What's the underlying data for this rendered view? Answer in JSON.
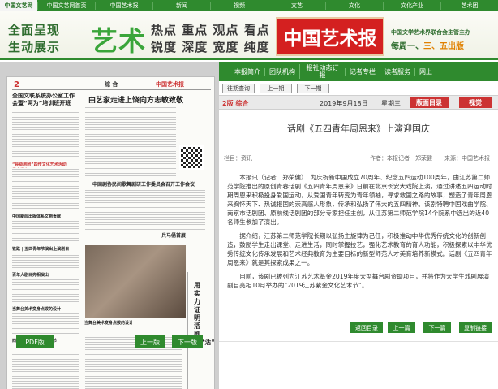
{
  "top_nav": {
    "logo": "中国文艺网",
    "items": [
      "中国文艺网首页",
      "中国艺术报",
      "新闻",
      "视频",
      "文艺",
      "文化",
      "文化产业",
      "艺术团"
    ]
  },
  "banner": {
    "line1": "全面呈现",
    "line2": "生动展示",
    "art": "艺术",
    "keywords1": "热点 重点 观点 看点",
    "keywords2": "锐度 深度 宽度 纯度",
    "masthead": "中国艺术报",
    "publisher": "中国文学艺术界联合会主管主办",
    "issue_prefix": "每周一、",
    "issue_days": "三、五出版"
  },
  "paper": {
    "page_num": "2",
    "section": "综 合",
    "masthead": "中国艺术报",
    "headline_left": "全国文联系统办公室工作会暨“两为”培训班开班",
    "headline_main": "由艺家走进上饶向方志敏致敬",
    "headline_red": "“县级剧团”四传文化艺术活动常态举办",
    "headline_mid": "中国剧协民间歌舞剧研工作委员会召开工作会议",
    "headline_b1": "中国新闻出版体系文物贡献",
    "headline_b2": "铁路 | 五四青年节演出上演剧目",
    "headline_b3": "百年大剧目亮相演出",
    "headline_b4": "当舞台美术变身点拨的设计",
    "headline_b5": "西藏山南文化表演艺术节",
    "headline_b6": "兵马俑首展",
    "headline_vert": "用实力证明活剧性“活”"
  },
  "left_buttons": {
    "pdf": "PDF版",
    "prev": "上一版",
    "next": "下一版"
  },
  "right_nav": {
    "items": [
      "本报简介",
      "团队机构",
      "报社动态订报",
      "记者专栏",
      "读者服务",
      "网上"
    ]
  },
  "sub_nav": {
    "past": "往期查询",
    "prev": "上一期",
    "next": "下一期"
  },
  "info_bar": {
    "section": "2版 综合",
    "date": "2019年9月18日",
    "weekday": "星期三",
    "toc_button": "版面目录",
    "view_button": "视觉"
  },
  "article": {
    "title": "话剧《五四青年周恩来》上演迎国庆",
    "column": "栏目：资讯",
    "author": "作者：本报记者　郑荣健",
    "source": "来源：中国艺术报",
    "paragraphs": [
      "本报讯（记者　郑荣健）　为庆祝新中国成立70周年、纪念五四运动100周年，由江苏第二师范学院推出的原创青春话剧《五四青年周恩来》日前在北京长安大戏院上演，通过讲述五四运动时期周恩来积极投身爱国运动，从爱国青年转变为青年领袖，寻求救国之路的故事，塑造了青年周恩来胸怀天下、热诚报国的崇高感人形象，传承和弘扬了伟大的五四精神。该剧特聘中国戏曲学院、南京市话剧团、原前线话剧团的部分专家担任主创，从江苏第二师范学院14个院系中选出的近40名师生参加了演出。",
      "据介绍，江苏第二师范学院长期以弘扬主旋律为己任，积极推动中华优秀传统文化的创新创造，鼓励学生走出课堂、走进生活，同时掌握技艺，强化艺术教育的育人功能，积极探索以中华优秀传统文化传承发展和艺术经典教育为主要目标的新型师范人才美育培养新模式。话剧《五四青年周恩来》就是其探索成果之一。",
      "目前，该剧已被列为江苏艺术基金2019年度大型舞台剧资助项目，并将作为大学生戏剧展演剧目亮相10月举办的“2019江苏紫金文化艺术节”。"
    ]
  },
  "article_buttons": {
    "back_toc": "返回目录",
    "prev": "上一篇",
    "next": "下一篇",
    "print": "复制链接"
  }
}
